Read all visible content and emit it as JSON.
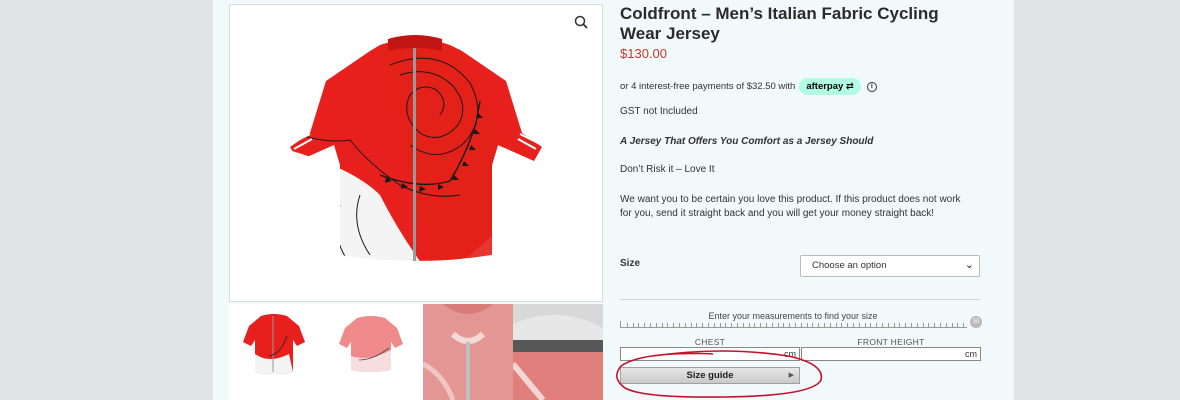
{
  "product": {
    "title": "Coldfront – Men’s Italian Fabric Cycling Wear Jersey",
    "price": "$130.00"
  },
  "afterpay": {
    "text": "or 4 interest-free payments of $32.50 with",
    "badge": "afterpay",
    "info": "i"
  },
  "details": {
    "gst": "GST not Included",
    "tagline": "A Jersey That Offers You Comfort as a Jersey Should",
    "dont_risk": "Don’t Risk it – Love It",
    "description": "We want you to be certain you love this product. If this product does not work for you, send it straight back and you will get your money straight back!"
  },
  "size": {
    "label": "Size",
    "selected": "Choose an option"
  },
  "size_finder": {
    "title": "Enter your measurements to find your size",
    "unit_toggle": "SI",
    "chest_label": "CHEST",
    "front_height_label": "FRONT HEIGHT",
    "unit": "cm",
    "size_guide_label": "Size guide"
  },
  "colors": {
    "jersey_red": "#e8201d",
    "price_red": "#c0392b",
    "afterpay_mint": "#b2fce4",
    "annotation_red": "#c8102e"
  },
  "icons": [
    "zoom-icon",
    "chevron-down-icon",
    "info-icon",
    "caret-right-icon"
  ]
}
